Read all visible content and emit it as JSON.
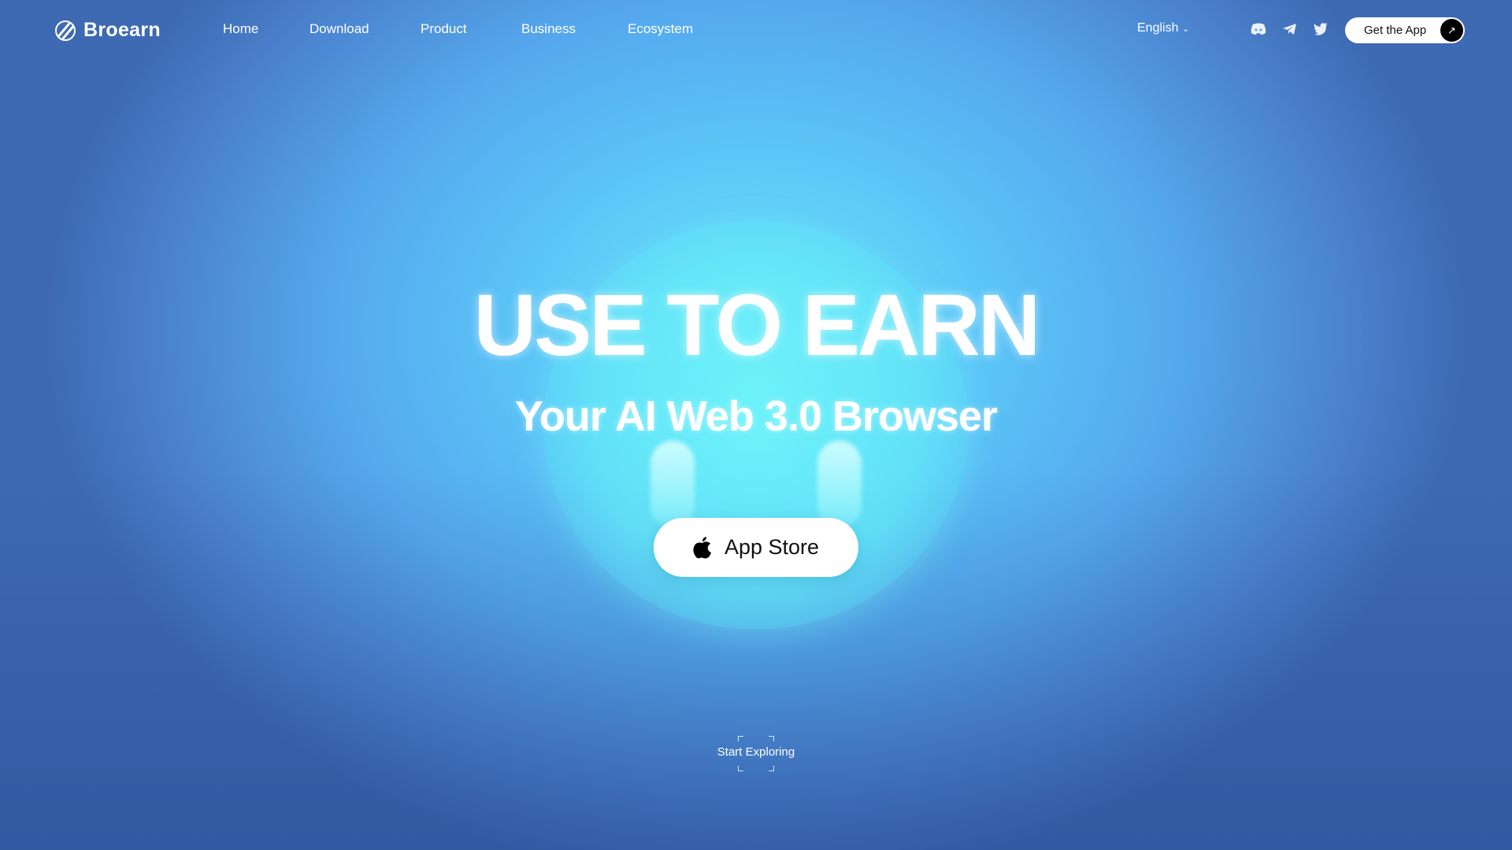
{
  "brand": {
    "name": "Broearn"
  },
  "nav": {
    "items": [
      "Home",
      "Download",
      "Product",
      "Business",
      "Ecosystem"
    ]
  },
  "header": {
    "language": "English",
    "social": [
      "discord-icon",
      "telegram-icon",
      "twitter-icon"
    ],
    "cta": "Get the App"
  },
  "hero": {
    "title": "USE TO EARN",
    "subtitle": "Your AI Web 3.0 Browser",
    "app_store": "App Store",
    "explore": "Start Exploring"
  },
  "colors": {
    "accent": "#5cc8f8",
    "button_bg": "#ffffff",
    "cta_icon_bg": "#000000"
  }
}
